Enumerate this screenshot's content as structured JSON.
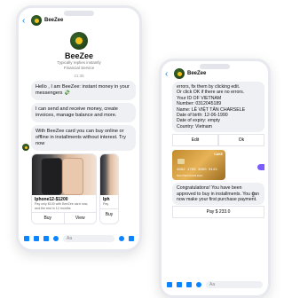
{
  "left_phone": {
    "header_name": "BeeZee",
    "profile": {
      "name": "BeeZee",
      "subtitle_1": "Typically replies instantly",
      "subtitle_2": "Financial Service",
      "time": "21:35"
    },
    "bubble_1": "Hello , I am BeeZee: instant money in your messengers 💸",
    "bubble_2": "I can send and receive money, create invoices, manage balance and more.",
    "bubble_3": "With BeeZee card you can buy online or offline in installments without interest. Try now",
    "cards": [
      {
        "title": "Iphone12-$1200",
        "desc": "Pay only $100 with BeeZee card now, and the rest in 12 months",
        "btn_buy": "Buy",
        "btn_view": "View"
      },
      {
        "title": "Iph",
        "desc": "Pay",
        "btn_buy": "Buy"
      }
    ],
    "composer_placeholder": "Aa"
  },
  "right_phone": {
    "header_name": "BeeZee",
    "info_bubble": [
      "errors, fix them by clicking edit.",
      "Or click OK if there are no errors.",
      "Your ID OF VIETNAM",
      "Number: 0312045189",
      "Name: LÊ VIỆT TÂN CHARSELE",
      "Date of birth: 12-06-1990",
      "Date of expiry: empty",
      "Country: Vietnam"
    ],
    "btn_edit": "Edit",
    "btn_ok": "Ok",
    "card_brand": "CAKE",
    "card_number": "4682 1700 3600 0143",
    "card_holder": "NGUYEN PHAN DAO",
    "congrats": "Congratulations! You have been approved to buy in installments. You can now make your first purchase payment.",
    "pay_button": "Pay $ 233.0",
    "composer_placeholder": "Aa"
  }
}
